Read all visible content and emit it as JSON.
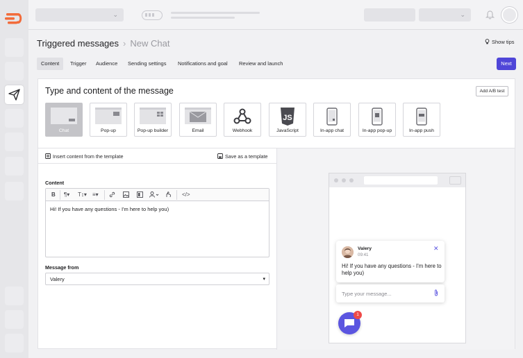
{
  "breadcrumb": {
    "title": "Triggered messages",
    "current": "New Chat"
  },
  "header_actions": {
    "show_tips": "Show tips",
    "next": "Next"
  },
  "tabs": [
    {
      "label": "Content",
      "active": true
    },
    {
      "label": "Trigger",
      "active": false
    },
    {
      "label": "Audience",
      "active": false
    },
    {
      "label": "Sending settings",
      "active": false
    },
    {
      "label": "Notifications and goal",
      "active": false
    },
    {
      "label": "Review and launch",
      "active": false
    }
  ],
  "panel": {
    "heading": "Type and content of the message",
    "ab_test": "Add A/B test"
  },
  "message_types": [
    {
      "label": "Chat",
      "icon": "chat-layout-icon",
      "active": true
    },
    {
      "label": "Pop-up",
      "icon": "popup-layout-icon",
      "active": false
    },
    {
      "label": "Pop-up builder",
      "icon": "popup-builder-icon",
      "active": false
    },
    {
      "label": "Email",
      "icon": "email-icon",
      "active": false
    },
    {
      "label": "Webhook",
      "icon": "webhook-icon",
      "active": false
    },
    {
      "label": "JavaScript",
      "icon": "javascript-icon",
      "active": false
    },
    {
      "label": "In-app chat",
      "icon": "phone-icon",
      "active": false
    },
    {
      "label": "In-app pop-up",
      "icon": "phone-popup-icon",
      "active": false
    },
    {
      "label": "In-app push",
      "icon": "phone-push-icon",
      "active": false
    }
  ],
  "template_bar": {
    "insert": "Insert content from the template",
    "save": "Save as a template"
  },
  "content": {
    "label": "Content",
    "text": "Hi! If you have any questions - I'm here to help you)"
  },
  "message_from": {
    "label": "Message from",
    "value": "Valery"
  },
  "preview": {
    "sender": "Valery",
    "time": "09:41",
    "message": "Hi! If you have any questions - I'm here to help you)",
    "input_placeholder": "Type your message...",
    "badge": "1"
  },
  "colors": {
    "accent": "#4f46d8",
    "badge": "#ef4a48",
    "logo": "#f26b3a"
  }
}
